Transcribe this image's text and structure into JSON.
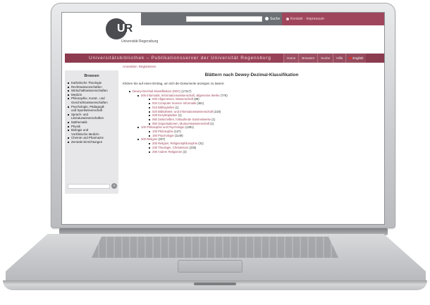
{
  "header": {
    "search_placeholder": "",
    "search_button": "Suche",
    "contact_link": "Kontakt · Impressum",
    "logo_letters_prefix": "U",
    "logo_letters_suffix": "R",
    "logo_subtitle": "Universität Regensburg"
  },
  "nav": {
    "title": "Universitätsbibliothek – Publikationsserver der Universität Regensburg",
    "tabs": [
      "Home",
      "Browsen",
      "Suche",
      "Hilfe"
    ],
    "lang": "English"
  },
  "sidebar": {
    "heading": "Browsen",
    "items": [
      {
        "text": "Katholische Theologie",
        "cont": false
      },
      {
        "text": "Rechtswissenschaften",
        "cont": false
      },
      {
        "text": "Wirtschaftswissenschaften",
        "cont": false
      },
      {
        "text": "Medizin",
        "cont": false
      },
      {
        "text": "Philosophie, Kunst-, und",
        "cont": false
      },
      {
        "text": "Geschichtswissenschaften",
        "cont": true
      },
      {
        "text": "Psychologie, Pädagogik",
        "cont": false
      },
      {
        "text": "und Sportwissenschaft",
        "cont": true
      },
      {
        "text": "Sprach- und",
        "cont": false
      },
      {
        "text": "Literaturwissenschaften",
        "cont": true
      },
      {
        "text": "Mathematik",
        "cont": false
      },
      {
        "text": "Physik",
        "cont": false
      },
      {
        "text": "Biologie und",
        "cont": false
      },
      {
        "text": "Vorklinische Medizin",
        "cont": true
      },
      {
        "text": "Chemie und Pharmazie",
        "cont": false
      },
      {
        "text": "Zentrale Einrichtungen",
        "cont": false
      }
    ],
    "search_button": "»"
  },
  "main": {
    "tabs": [
      "Anmelden",
      "Registrieren"
    ],
    "title": "Blättern nach Dewey-Dezimal-Klassifikation",
    "intro": "Klicken Sie auf einen Eintrag, um sich die Dokumente anzeigen zu lassen:",
    "tree": [
      {
        "level": 0,
        "label": "Dewey-Dezimal-Klassifikation (DDC)",
        "count": "(17117)"
      },
      {
        "level": 1,
        "label": "000 Informatik, Informationswissenschaft, allgemeine Werke",
        "count": "(776)"
      },
      {
        "level": 2,
        "label": "000 Allgemeines, Wissenschaft",
        "count": "(88)"
      },
      {
        "level": 2,
        "label": "004 Computer Science Informatik",
        "count": "(461)"
      },
      {
        "level": 2,
        "label": "010 Bibliografien",
        "count": "(1)"
      },
      {
        "level": 2,
        "label": "020 Bibliotheks- und Informationswissenschaft",
        "count": "(219)"
      },
      {
        "level": 2,
        "label": "030 Enzyklopädien",
        "count": "(1)"
      },
      {
        "level": 2,
        "label": "050 Zeitschriften, fortlaufende Sammelwerke",
        "count": "(1)"
      },
      {
        "level": 2,
        "label": "060 Organisationen, Museumswissenschaft",
        "count": "(1)"
      },
      {
        "level": 1,
        "label": "100 Philosophie und Psychologie",
        "count": "(1291)"
      },
      {
        "level": 2,
        "label": "100 Philosophie",
        "count": "(127)"
      },
      {
        "level": 2,
        "label": "150 Psychologie",
        "count": "(1149)"
      },
      {
        "level": 1,
        "label": "200 Religion",
        "count": "(237)"
      },
      {
        "level": 2,
        "label": "200 Religion, Religionsphilosophie",
        "count": "(31)"
      },
      {
        "level": 2,
        "label": "230 Theologie, Christentum",
        "count": "(235)"
      },
      {
        "level": 2,
        "label": "290 Andere Religionen",
        "count": "(2)"
      }
    ]
  }
}
